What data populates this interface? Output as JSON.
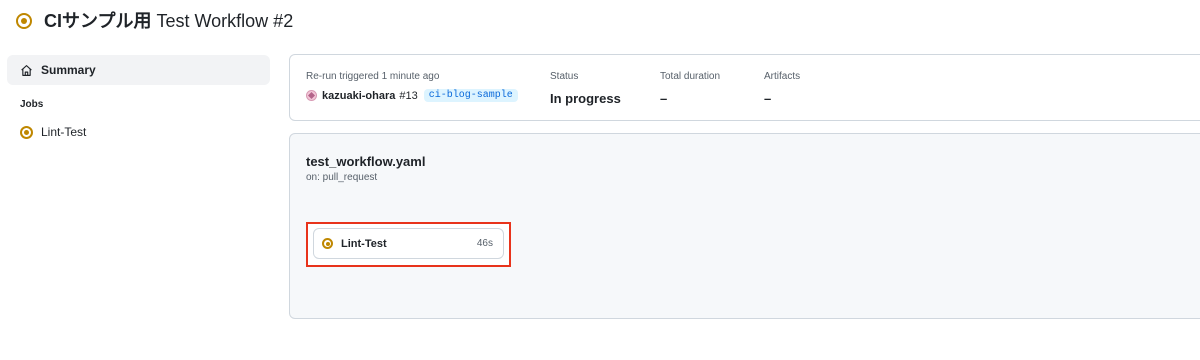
{
  "header": {
    "title_prefix": "CIサンプル用",
    "title_rest": "Test Workflow #2"
  },
  "sidebar": {
    "summary_label": "Summary",
    "jobs_heading": "Jobs",
    "jobs": [
      {
        "label": "Lint-Test"
      }
    ]
  },
  "summary": {
    "trigger_label": "Re-run triggered 1 minute ago",
    "actor": "kazuaki-ohara",
    "pr_number": "#13",
    "branch": "ci-blog-sample",
    "status_label": "Status",
    "status_value": "In progress",
    "duration_label": "Total duration",
    "duration_value": "–",
    "artifacts_label": "Artifacts",
    "artifacts_value": "–"
  },
  "graph": {
    "workflow_file": "test_workflow.yaml",
    "trigger": "on: pull_request",
    "job": {
      "name": "Lint-Test",
      "duration": "46s"
    }
  },
  "colors": {
    "in_progress": "#bf8700",
    "highlight": "#e8331b",
    "branch_text": "#0969da",
    "branch_bg": "#ddf4ff"
  }
}
